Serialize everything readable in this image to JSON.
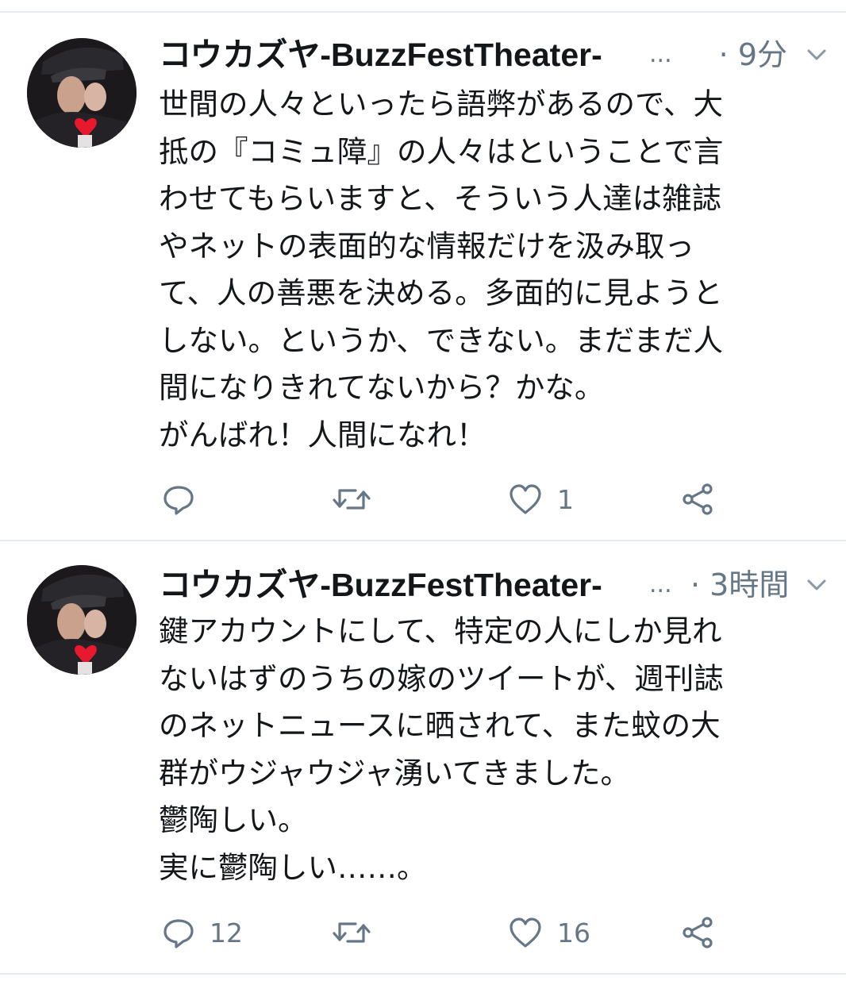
{
  "tweets": [
    {
      "author": "コウカズヤ-BuzzFestTheater-",
      "ellipsis": "...",
      "time": "· 9分",
      "text": "世間の人々といったら語弊があるので、大\n抵の『コミュ障』の人々はということで言\nわせてもらいますと、そういう人達は雑誌\nやネットの表面的な情報だけを汲み取っ\nて、人の善悪を決める。多面的に見ようと\nしない。というか、できない。まだまだ人\n間になりきれてないから？かな。\nがんばれ！人間になれ！",
      "reply_count": "",
      "retweet_count": "",
      "like_count": "1"
    },
    {
      "author": "コウカズヤ-BuzzFestTheater-",
      "ellipsis": "...",
      "time": "· 3時間",
      "text": "鍵アカウントにして、特定の人にしか見れ\nないはずのうちの嫁のツイートが、週刊誌\nのネットニュースに晒されて、また蚊の大\n群がウジャウジャ湧いてきました。\n鬱陶しい。\n実に鬱陶しい……。",
      "reply_count": "12",
      "retweet_count": "",
      "like_count": "16"
    }
  ],
  "icons": {
    "reply": "reply-icon",
    "retweet": "retweet-icon",
    "like": "heart-icon",
    "share": "share-icon",
    "more": "chevron-down-icon"
  },
  "colors": {
    "text": "#14171a",
    "secondary": "#657786",
    "divider": "#e6ecf0",
    "heart_sticker": "#e8192c"
  }
}
